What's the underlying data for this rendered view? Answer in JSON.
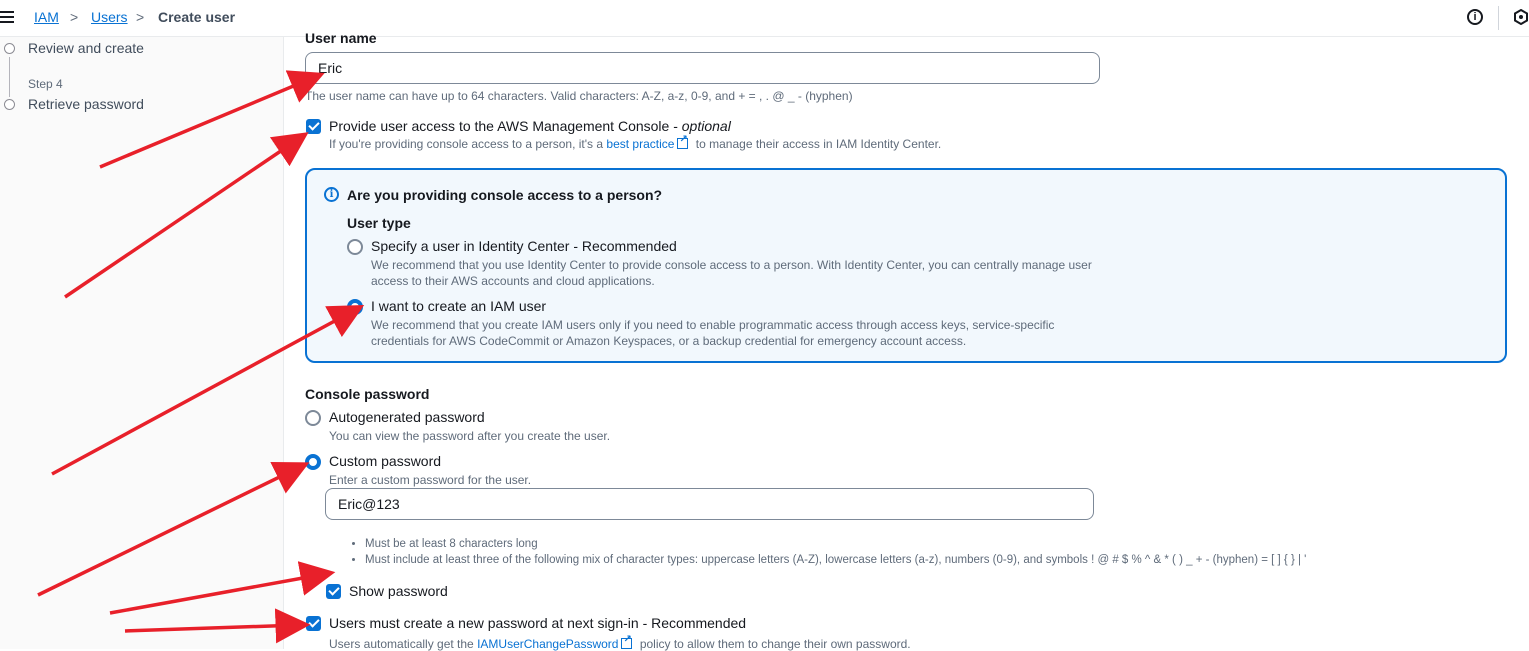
{
  "breadcrumb": {
    "iam": "IAM",
    "users": "Users",
    "current": "Create user",
    "separator": ">"
  },
  "topbar": {
    "info_glyph": "i"
  },
  "sidenav": {
    "review_label": "Review and create",
    "step4_label": "Step 4",
    "retrieve_label": "Retrieve password"
  },
  "form": {
    "username_label": "User name",
    "username_value": "Eric",
    "username_hint": "The user name can have up to 64 characters. Valid characters: A-Z, a-z, 0-9, and + = , . @ _ - (hyphen)",
    "console_access": {
      "label": "Provide user access to the AWS Management Console - ",
      "label_optional": "optional",
      "desc_prefix": "If you're providing console access to a person, it's a ",
      "desc_link": "best practice",
      "desc_suffix": " to manage their access in IAM Identity Center.",
      "checked": true
    },
    "alert": {
      "title": "Are you providing console access to a person?",
      "user_type_label": "User type",
      "option1_label": "Specify a user in Identity Center - Recommended",
      "option1_desc": "We recommend that you use Identity Center to provide console access to a person. With Identity Center, you can centrally manage user access to their AWS accounts and cloud applications.",
      "option2_label": "I want to create an IAM user",
      "option2_desc": "We recommend that you create IAM users only if you need to enable programmatic access through access keys, service-specific credentials for AWS CodeCommit or Amazon Keyspaces, or a backup credential for emergency account access.",
      "selected": "option2"
    },
    "console_password": {
      "label": "Console password",
      "auto_label": "Autogenerated password",
      "auto_desc": "You can view the password after you create the user.",
      "custom_label": "Custom password",
      "custom_desc": "Enter a custom password for the user.",
      "custom_value": "Eric@123",
      "selected": "custom",
      "rules": [
        "Must be at least 8 characters long",
        "Must include at least three of the following mix of character types: uppercase letters (A-Z), lowercase letters (a-z), numbers (0-9), and symbols ! @ # $ % ^ & * ( ) _ + - (hyphen) = [ ] { } | '"
      ],
      "show_password_label": "Show password",
      "show_password_checked": true
    },
    "force_reset": {
      "label": "Users must create a new password at next sign-in - Recommended",
      "desc_prefix": "Users automatically get the ",
      "desc_link": "IAMUserChangePassword",
      "desc_suffix": " policy to allow them to change their own password.",
      "checked": true
    }
  },
  "annotation_color": "#e8202a"
}
